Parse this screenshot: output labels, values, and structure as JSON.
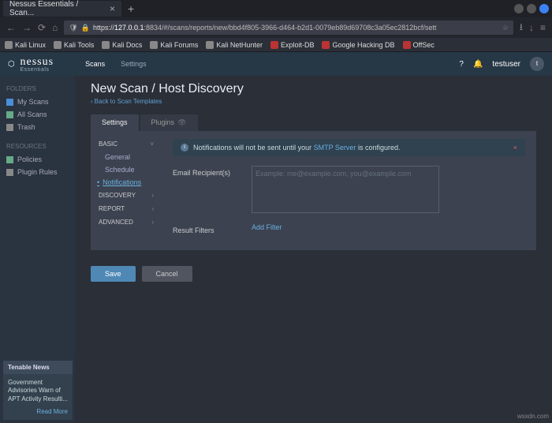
{
  "browser": {
    "tab_title": "Nessus Essentials / Scan...",
    "url_host": "127.0.0.1",
    "url_port_path": ":8834/#/scans/reports/new/bbd4f805-3966-d464-b2d1-0079eb89d69708c3a05ec2812bcf/sett",
    "bookmarks": [
      "Kali Linux",
      "Kali Tools",
      "Kali Docs",
      "Kali Forums",
      "Kali NetHunter",
      "Exploit-DB",
      "Google Hacking DB",
      "OffSec"
    ]
  },
  "header": {
    "brand": "nessus",
    "sub": "Essentials",
    "nav_scans": "Scans",
    "nav_settings": "Settings",
    "user": "testuser",
    "avatar_initial": "t"
  },
  "sidebar": {
    "folders_head": "FOLDERS",
    "my_scans": "My Scans",
    "all_scans": "All Scans",
    "trash": "Trash",
    "resources_head": "RESOURCES",
    "policies": "Policies",
    "plugin_rules": "Plugin Rules"
  },
  "page": {
    "title": "New Scan / Host Discovery",
    "back": "Back to Scan Templates",
    "tab_settings": "Settings",
    "tab_plugins": "Plugins"
  },
  "cats": {
    "basic": "BASIC",
    "basic_general": "General",
    "basic_schedule": "Schedule",
    "basic_notifications": "Notifications",
    "discovery": "DISCOVERY",
    "report": "REPORT",
    "advanced": "ADVANCED"
  },
  "form": {
    "alert_pre": "Notifications will not be sent until your ",
    "alert_link": "SMTP Server",
    "alert_post": " is configured.",
    "recipients_label": "Email Recipient(s)",
    "recipients_placeholder": "Example: me@example.com, you@example.com",
    "filters_label": "Result Filters",
    "add_filter": "Add Filter",
    "save": "Save",
    "cancel": "Cancel"
  },
  "news": {
    "head": "Tenable News",
    "body": "Government Advisories Warn of APT Activity Resulti...",
    "more": "Read More"
  },
  "watermark": "wsxdn.com"
}
